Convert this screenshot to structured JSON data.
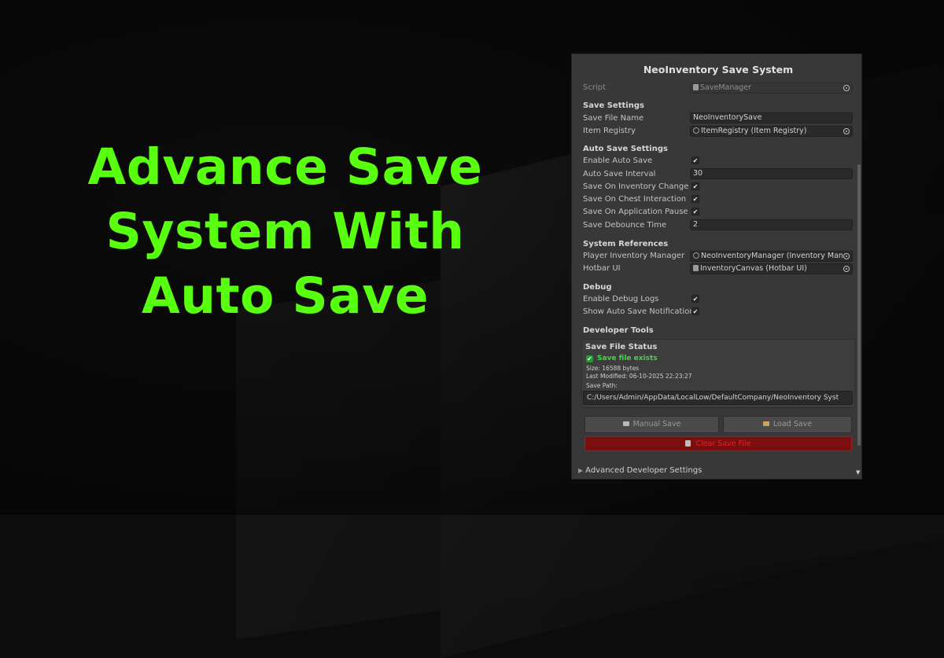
{
  "headline": {
    "line1": "Advance Save",
    "line2": "System With",
    "line3": "Auto Save"
  },
  "inspector": {
    "title": "NeoInventory Save System",
    "script": {
      "label": "Script",
      "value": "SaveManager"
    },
    "save_settings": {
      "header": "Save Settings",
      "save_file_name": {
        "label": "Save File Name",
        "value": "NeoInventorySave"
      },
      "item_registry": {
        "label": "Item Registry",
        "value": "ItemRegistry (Item Registry)"
      }
    },
    "auto_save_settings": {
      "header": "Auto Save Settings",
      "enable_auto_save": {
        "label": "Enable Auto Save",
        "checked": true
      },
      "auto_save_interval": {
        "label": "Auto Save Interval",
        "value": "30"
      },
      "save_on_inventory_change": {
        "label": "Save On Inventory Change",
        "checked": true
      },
      "save_on_chest_interaction": {
        "label": "Save On Chest Interaction",
        "checked": true
      },
      "save_on_application_pause": {
        "label": "Save On Application Pause",
        "checked": true
      },
      "save_debounce_time": {
        "label": "Save Debounce Time",
        "value": "2"
      }
    },
    "system_references": {
      "header": "System References",
      "player_inventory_manager": {
        "label": "Player Inventory Manager",
        "value": "NeoInventoryManager (Inventory Mana"
      },
      "hotbar_ui": {
        "label": "Hotbar UI",
        "value": "InventoryCanvas (Hotbar UI)"
      }
    },
    "debug": {
      "header": "Debug",
      "enable_debug_logs": {
        "label": "Enable Debug Logs",
        "checked": true
      },
      "show_auto_save_notification": {
        "label": "Show Auto Save Notification",
        "checked": true
      }
    },
    "developer_tools": {
      "header": "Developer Tools",
      "status_title": "Save File Status",
      "exists_text": "Save file exists",
      "size_text": "Size: 16588 bytes",
      "modified_text": "Last Modified: 06-10-2025 22:23:27",
      "path_label": "Save Path:",
      "path_value": "C:/Users/Admin/AppData/LocalLow/DefaultCompany/NeoInventory Syst",
      "manual_save": "Manual Save",
      "load_save": "Load Save",
      "clear_save": "Clear Save File"
    },
    "advanced": "Advanced Developer Settings",
    "check_glyph": "✔",
    "colors": {
      "headline": "#58ff0f",
      "panel_bg": "#383838",
      "exists_green": "#3ddc3d",
      "clear_red": "#e02525"
    }
  }
}
